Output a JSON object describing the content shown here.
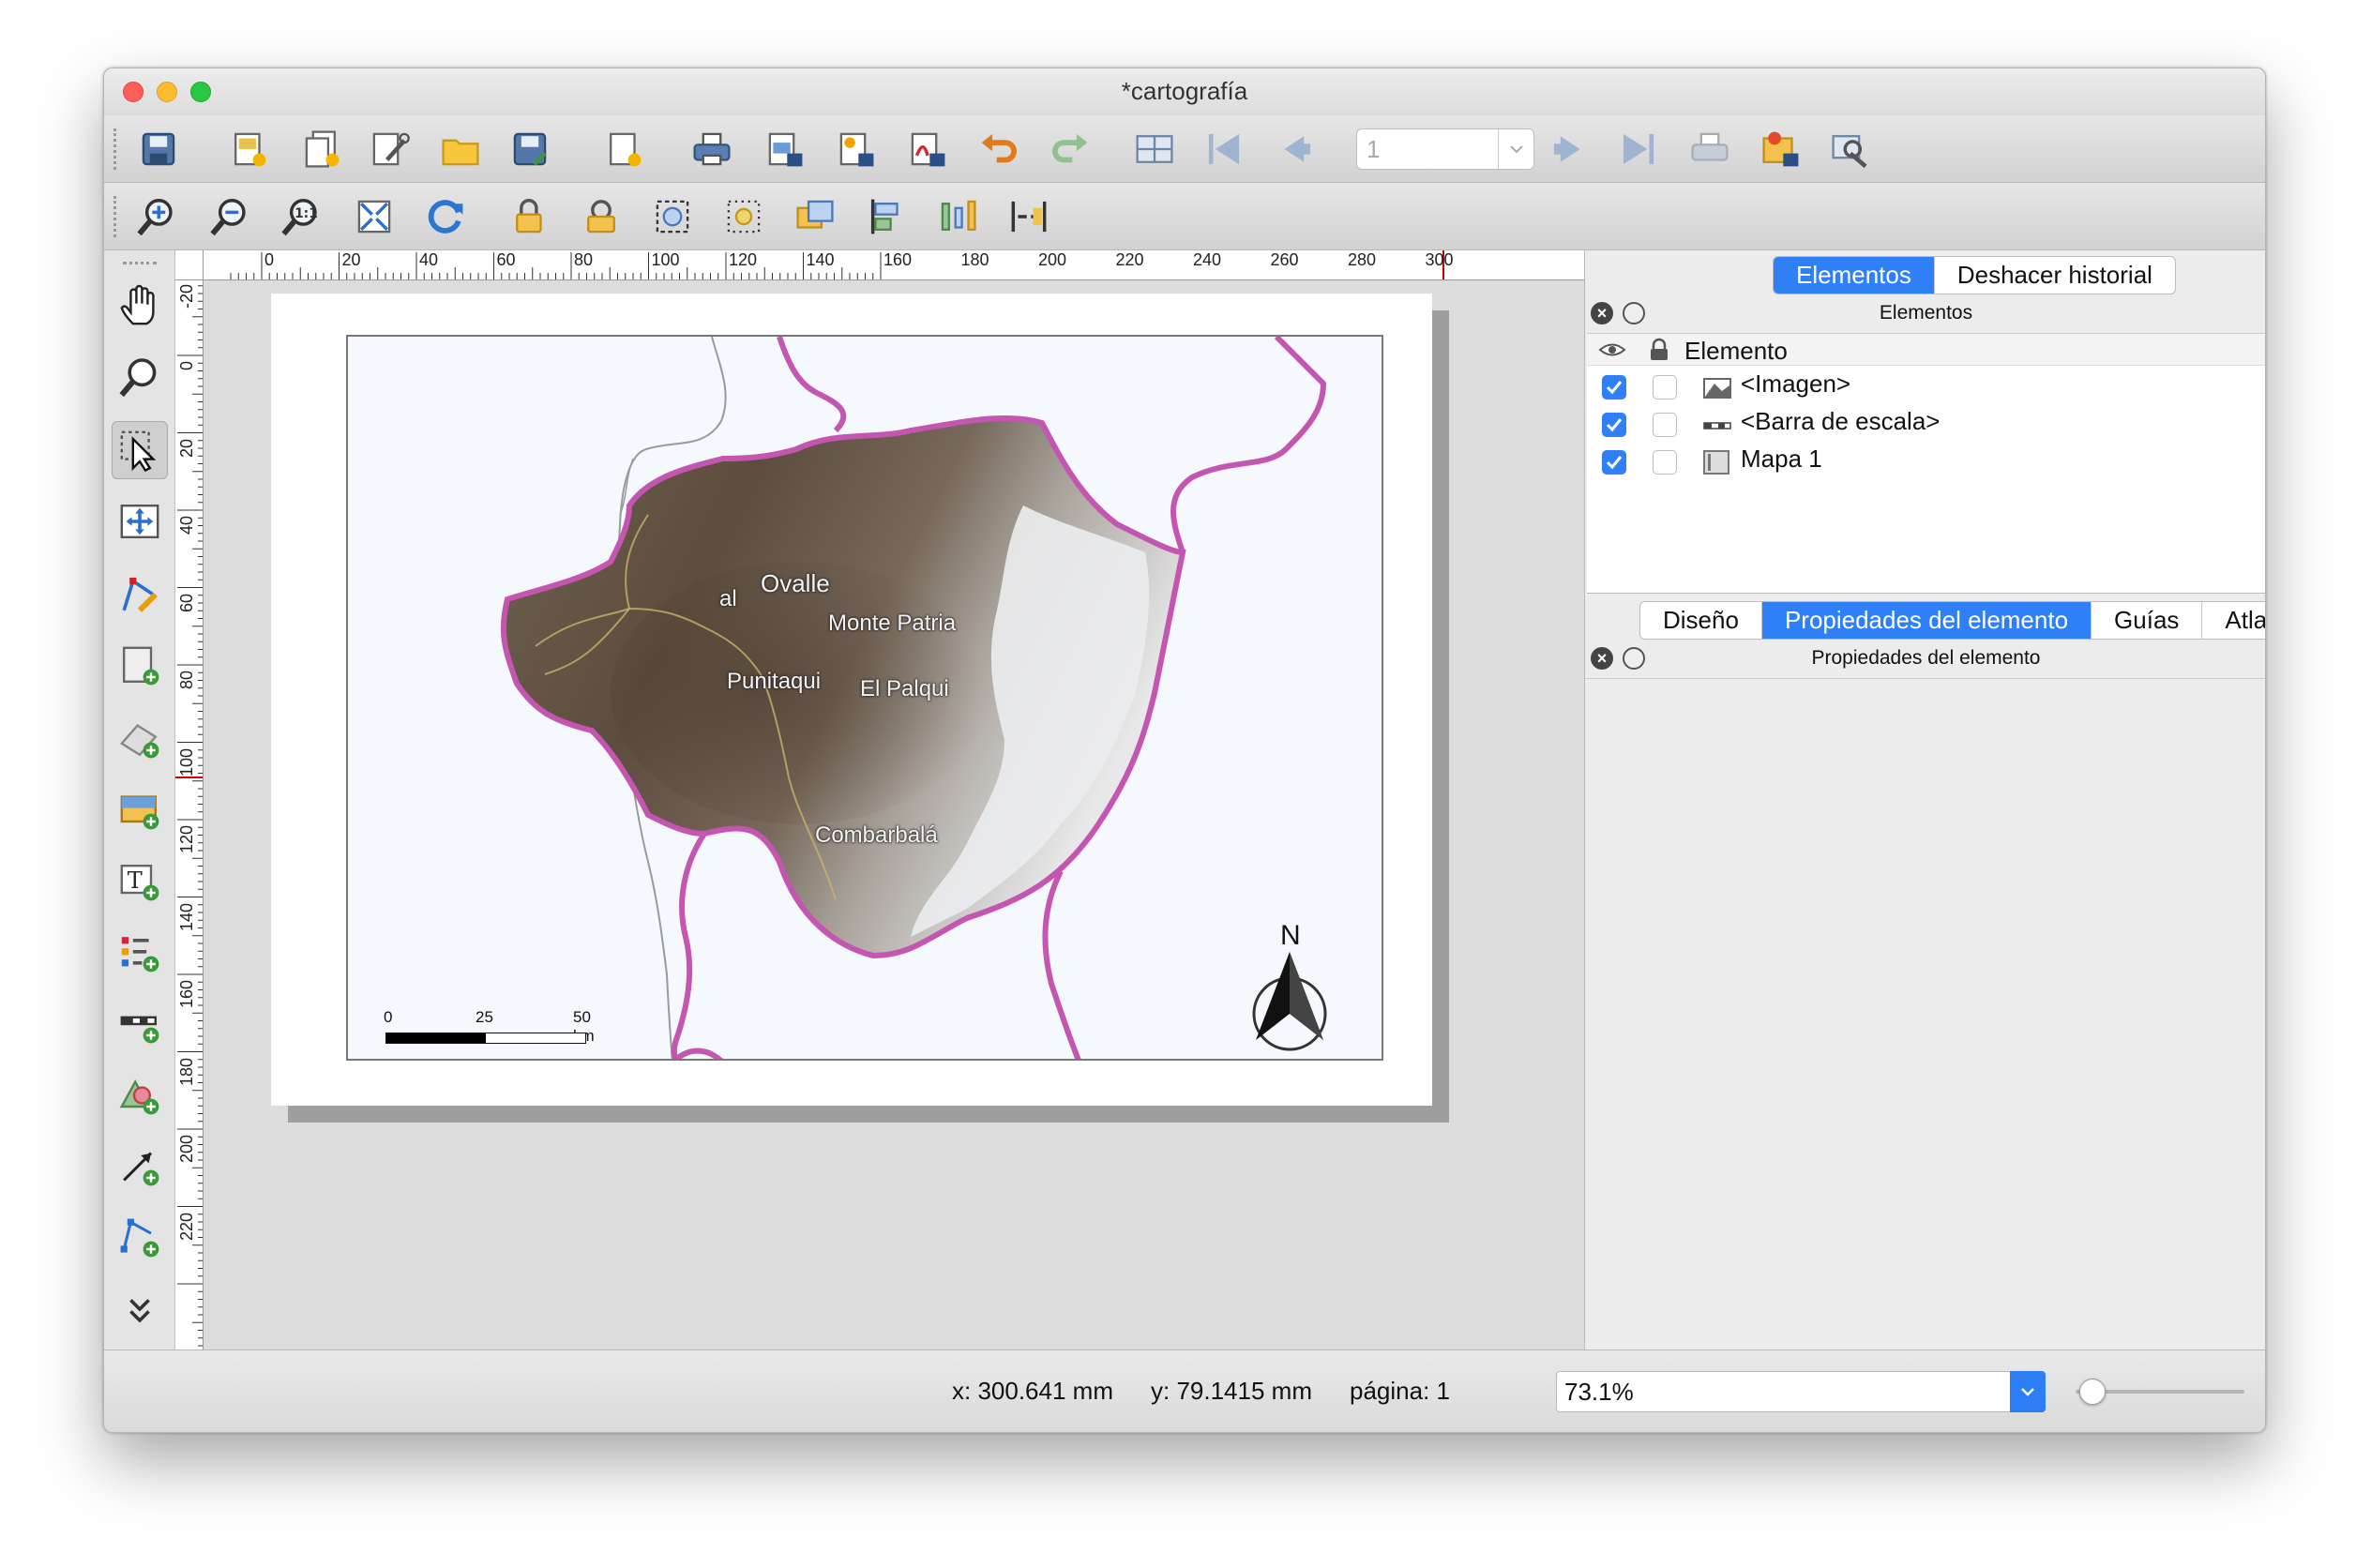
{
  "window": {
    "title": "*cartografía"
  },
  "toolbar": {
    "main": [
      "save-icon",
      "new-layout-icon",
      "duplicate-layout-icon",
      "layout-manager-icon",
      "open-template-icon",
      "save-template-icon",
      "add-page-icon",
      "print-icon",
      "export-image-icon",
      "export-svg-icon",
      "export-pdf-icon",
      "undo-icon",
      "redo-icon",
      "atlas-preview-icon",
      "first-feature-icon",
      "previous-feature-icon",
      "next-feature-icon",
      "last-feature-icon",
      "atlas-print-icon",
      "atlas-export-icon",
      "atlas-settings-icon"
    ],
    "atlas_page_value": "1",
    "view": [
      "zoom-in-icon",
      "zoom-out-icon",
      "zoom-actual-icon",
      "zoom-full-icon",
      "refresh-icon",
      "lock-items-icon",
      "unlock-items-icon",
      "group-icon",
      "ungroup-icon",
      "raise-icon",
      "align-icon",
      "distribute-icon",
      "resize-icon"
    ]
  },
  "left_tools": [
    "pan-icon",
    "zoom-tool-icon",
    "select-icon",
    "move-content-icon",
    "edit-nodes-icon",
    "add-map-icon",
    "add-3d-map-icon",
    "add-picture-icon",
    "add-label-icon",
    "add-legend-icon",
    "add-scalebar-icon",
    "add-shape-icon",
    "add-arrow-icon",
    "add-node-item-icon",
    "more-tools-icon"
  ],
  "ruler": {
    "h_labels": [
      "0",
      "20",
      "40",
      "60",
      "80",
      "100",
      "120",
      "140",
      "160",
      "180",
      "200",
      "220",
      "240",
      "260",
      "280",
      "300"
    ],
    "v_labels": [
      "-20",
      "0",
      "20",
      "40",
      "60",
      "80",
      "100",
      "120",
      "140",
      "160",
      "180",
      "200",
      "220"
    ]
  },
  "map": {
    "places": [
      "Ovalle",
      "Monte Patria",
      "Punitaqui",
      "El Palqui",
      "Combarbalá",
      "al"
    ],
    "scalebar": {
      "labels": [
        "0",
        "25",
        "50 km"
      ],
      "fill_fraction": 0.5
    },
    "north_arrow": {
      "label": "N"
    }
  },
  "panel": {
    "top_tabs": [
      "Elementos",
      "Deshacer historial"
    ],
    "top_active": 0,
    "items_title": "Elementos",
    "column_header": "Elemento",
    "items": [
      {
        "label": "<Imagen>",
        "visible": true,
        "locked": false,
        "icon": "picture-item-icon"
      },
      {
        "label": "<Barra de escala>",
        "visible": true,
        "locked": false,
        "icon": "scalebar-item-icon"
      },
      {
        "label": "Mapa 1",
        "visible": true,
        "locked": false,
        "icon": "map-item-icon"
      }
    ],
    "bottom_tabs": [
      "Diseño",
      "Propiedades del elemento",
      "Guías",
      "Atlas"
    ],
    "bottom_active": 1,
    "props_title": "Propiedades del elemento"
  },
  "status": {
    "x": "x: 300.641 mm",
    "y": "y: 79.1415 mm",
    "page": "página: 1",
    "zoom": "73.1%",
    "zoom_fraction": 0.1
  },
  "colors": {
    "accent": "#2f80f6",
    "boundary": "#c455b0",
    "terrain": "#6b5a48",
    "snow": "#ecedf0"
  }
}
